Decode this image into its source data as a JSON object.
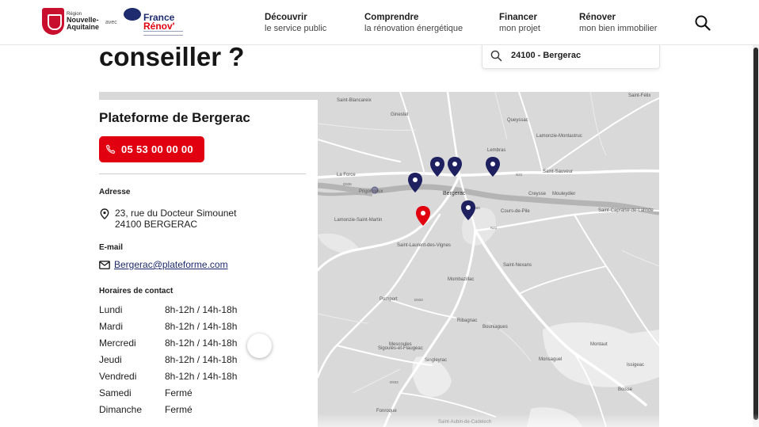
{
  "header": {
    "region_logo": {
      "small": "Région",
      "name_line1": "Nouvelle-",
      "name_line2": "Aquitaine"
    },
    "avec": "avec",
    "france_renov": {
      "line1": "France",
      "line2": "Rénov'"
    },
    "nav": [
      {
        "title": "Découvrir",
        "subtitle": "le service public"
      },
      {
        "title": "Comprendre",
        "subtitle": "la rénovation énergétique"
      },
      {
        "title": "Financer",
        "subtitle": "mon projet"
      },
      {
        "title": "Rénover",
        "subtitle": "mon bien immobilier"
      }
    ],
    "search_icon": "search-icon"
  },
  "main": {
    "title": "conseiller ?",
    "search": {
      "value": "24100 - Bergerac",
      "icon": "search-icon"
    }
  },
  "card": {
    "title": "Plateforme de Bergerac",
    "phone": "05 53 00 00 00",
    "address_label": "Adresse",
    "address_line1": "23, rue du Docteur Simounet",
    "address_line2": "24100 BERGERAC",
    "email_label": "E-mail",
    "email": "Bergerac@plateforme.com",
    "hours_label": "Horaires de contact",
    "hours": [
      {
        "day": "Lundi",
        "time": "8h-12h / 14h-18h"
      },
      {
        "day": "Mardi",
        "time": "8h-12h / 14h-18h"
      },
      {
        "day": "Mercredi",
        "time": "8h-12h / 14h-18h"
      },
      {
        "day": "Jeudi",
        "time": "8h-12h / 14h-18h"
      },
      {
        "day": "Vendredi",
        "time": "8h-12h / 14h-18h"
      },
      {
        "day": "Samedi",
        "time": "Fermé"
      },
      {
        "day": "Dimanche",
        "time": "Fermé"
      }
    ]
  },
  "map": {
    "place_labels": [
      "Saint-Félix",
      "Saint-Blancareix",
      "Ginestet",
      "Queyssac",
      "Lamonzie-Montastruc",
      "Lembras",
      "La Force",
      "Saint-Sauveur",
      "Prigonrieux",
      "Bergerac",
      "Creysse",
      "Mouleydier",
      "Lamonzie-Saint-Martin",
      "Cours-de-Pile",
      "Saint-Capraise-de-Lalinde",
      "Saint-Laurent-des-Vignes",
      "Saint-Nexans",
      "Mombazillac",
      "Pomport",
      "Ribagnac",
      "Bouniagues",
      "Sigoulès-et-Flaugeac",
      "Mescoules",
      "Singleyrac",
      "Montaut",
      "Monsaguel",
      "Issigeac",
      "Boisse",
      "Fonroque",
      "Saint-Aubin-de-Cadelech"
    ],
    "road_labels": [
      "D936",
      "N21",
      "D933",
      "D933",
      "D660"
    ],
    "colors": {
      "marker": "#1e2060",
      "selected_marker": "#e1000f",
      "water": "#b4b4b4",
      "land": "#d9d9d9"
    }
  }
}
